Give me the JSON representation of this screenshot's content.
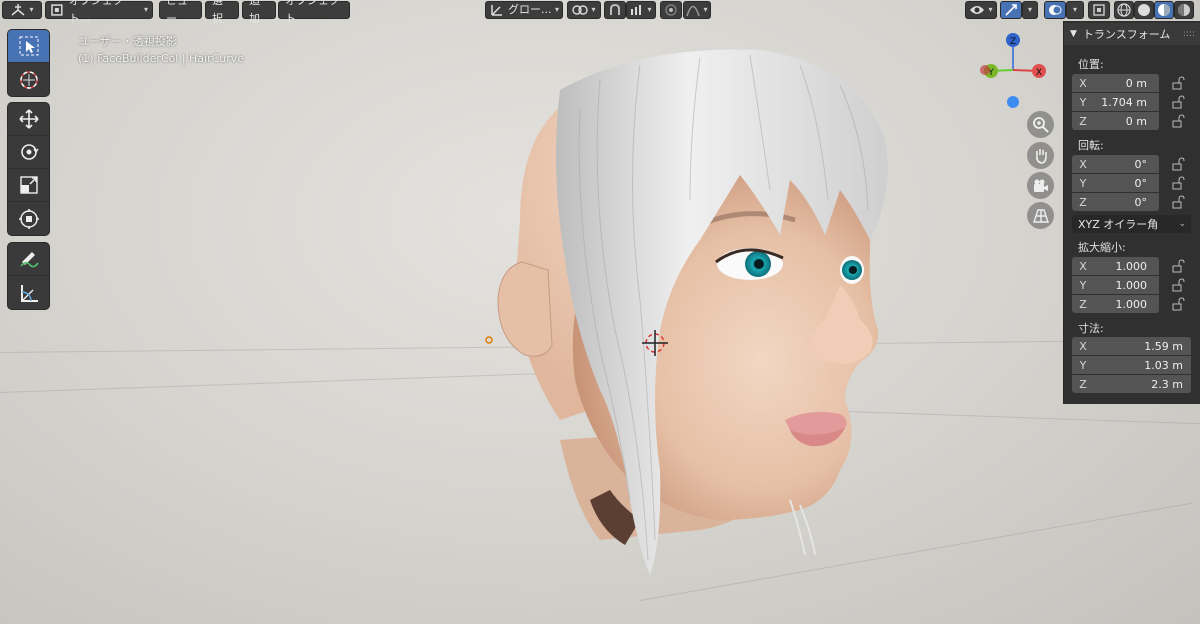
{
  "header": {
    "mode_label": "オブジェクト...",
    "menus": [
      "ビュー",
      "選択",
      "追加",
      "オブジェクト"
    ],
    "transform_orientation": "グロー..."
  },
  "viewport": {
    "view_name": "ユーザー・透視投影",
    "object_info": "(1) FaceBuilderCol | HairCurve"
  },
  "gizmo": {
    "z": "Z",
    "y": "Y",
    "x": "X"
  },
  "npanel": {
    "title": "トランスフォーム",
    "location_label": "位置:",
    "location": [
      {
        "axis": "X",
        "value": "0 m"
      },
      {
        "axis": "Y",
        "value": "1.704 m"
      },
      {
        "axis": "Z",
        "value": "0 m"
      }
    ],
    "rotation_label": "回転:",
    "rotation": [
      {
        "axis": "X",
        "value": "0°"
      },
      {
        "axis": "Y",
        "value": "0°"
      },
      {
        "axis": "Z",
        "value": "0°"
      }
    ],
    "rotation_mode": "XYZ オイラー角",
    "scale_label": "拡大縮小:",
    "scale": [
      {
        "axis": "X",
        "value": "1.000"
      },
      {
        "axis": "Y",
        "value": "1.000"
      },
      {
        "axis": "Z",
        "value": "1.000"
      }
    ],
    "dimensions_label": "寸法:",
    "dimensions": [
      {
        "axis": "X",
        "value": "1.59 m"
      },
      {
        "axis": "Y",
        "value": "1.03 m"
      },
      {
        "axis": "Z",
        "value": "2.3 m"
      }
    ]
  },
  "colors": {
    "accent": "#4772b3",
    "header_button": "#3d3d3d",
    "panel": "#303030",
    "hair": "#e8e8e8",
    "skin": "#e9c9b2",
    "iris": "#1aa7b0"
  }
}
